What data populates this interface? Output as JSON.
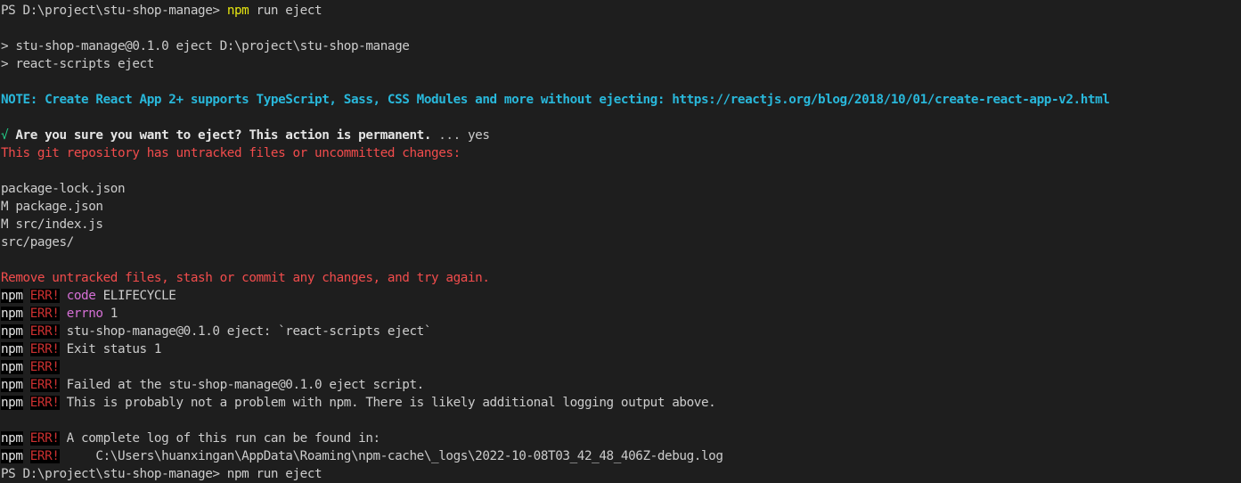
{
  "terminal": {
    "top_partial": "",
    "prompt": {
      "ps_label": "PS D:\\project\\stu-shop-manage> ",
      "command_bin": "npm",
      "command_args": " run eject"
    },
    "script_header": [
      "> stu-shop-manage@0.1.0 eject D:\\project\\stu-shop-manage",
      "> react-scripts eject"
    ],
    "note": "NOTE: Create React App 2+ supports TypeScript, Sass, CSS Modules and more without ejecting: https://reactjs.org/blog/2018/10/01/create-react-app-v2.html",
    "confirm": {
      "check": "√",
      "question": "Are you sure you want to eject? This action is permanent.",
      "dots": " ... ",
      "answer": "yes"
    },
    "git_warning": "This git repository has untracked files or uncommitted changes:",
    "files": [
      "package-lock.json",
      "M package.json",
      "M src/index.js",
      "src/pages/"
    ],
    "remove_hint": "Remove untracked files, stash or commit any changes, and try again.",
    "npm_label": "npm",
    "err_label": "ERR!",
    "errors": [
      {
        "key": "code",
        "value": " ELIFECYCLE"
      },
      {
        "key": "errno",
        "value": " 1"
      }
    ],
    "err_lines": [
      " stu-shop-manage@0.1.0 eject: `react-scripts eject`",
      " Exit status 1",
      "",
      " Failed at the stu-shop-manage@0.1.0 eject script.",
      " This is probably not a problem with npm. There is likely additional logging output above."
    ],
    "log_lines": [
      " A complete log of this run can be found in:",
      "     C:\\Users\\huanxingan\\AppData\\Roaming\\npm-cache\\_logs\\2022-10-08T03_42_48_406Z-debug.log"
    ],
    "bottom_partial": "PS D:\\project\\stu-shop-manage> npm run eject"
  }
}
